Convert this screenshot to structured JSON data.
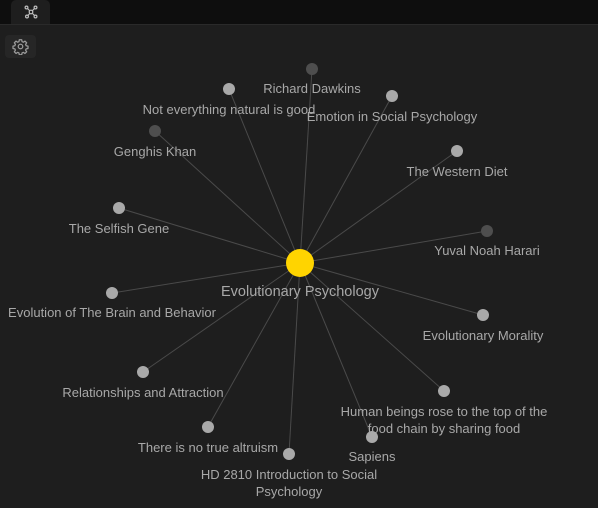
{
  "tab": {
    "icon": "graph-view-icon"
  },
  "toolbar": {
    "settings_icon": "gear-icon"
  },
  "colors": {
    "background": "#1e1e1e",
    "edge": "#4a4a4a",
    "node_resolved": "#a9a9a9",
    "node_unresolved": "#4e4e4e",
    "node_focused": "#ffd400",
    "label": "#a8a8a8"
  },
  "graph": {
    "center": {
      "id": "evolutionary-psychology",
      "label": "Evolutionary Psychology"
    },
    "nodes": [
      {
        "id": "richard-dawkins",
        "lines": [
          "Richard Dawkins"
        ],
        "resolved": false
      },
      {
        "id": "not-everything-natural-is-good",
        "lines": [
          "Not everything natural is good"
        ],
        "resolved": true
      },
      {
        "id": "emotion-in-social-psychology",
        "lines": [
          "Emotion in Social Psychology"
        ],
        "resolved": true
      },
      {
        "id": "genghis-khan",
        "lines": [
          "Genghis Khan"
        ],
        "resolved": false
      },
      {
        "id": "the-western-diet",
        "lines": [
          "The Western Diet"
        ],
        "resolved": true
      },
      {
        "id": "the-selfish-gene",
        "lines": [
          "The Selfish Gene"
        ],
        "resolved": true
      },
      {
        "id": "yuval-noah-harari",
        "lines": [
          "Yuval Noah Harari"
        ],
        "resolved": false
      },
      {
        "id": "evolution-of-the-brain-and-behavior",
        "lines": [
          "Evolution of The Brain and Behavior"
        ],
        "resolved": true
      },
      {
        "id": "evolutionary-morality",
        "lines": [
          "Evolutionary Morality"
        ],
        "resolved": true
      },
      {
        "id": "relationships-and-attraction",
        "lines": [
          "Relationships and Attraction"
        ],
        "resolved": true
      },
      {
        "id": "human-beings-rose-to-the-top",
        "lines": [
          "Human beings rose to the top of the",
          "food chain by sharing food"
        ],
        "resolved": true
      },
      {
        "id": "there-is-no-true-altruism",
        "lines": [
          "There is no true altruism"
        ],
        "resolved": true
      },
      {
        "id": "sapiens",
        "lines": [
          "Sapiens"
        ],
        "resolved": true
      },
      {
        "id": "hd-2810-introduction-to-social-psychology",
        "lines": [
          "HD 2810 Introduction to Social",
          "Psychology"
        ],
        "resolved": true
      }
    ]
  }
}
